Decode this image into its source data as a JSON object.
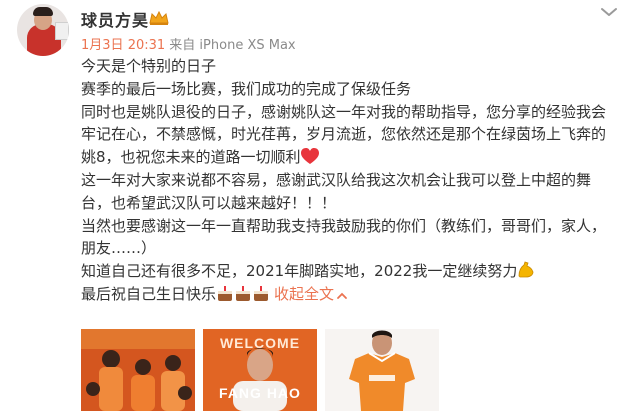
{
  "user": {
    "name": "球员方昊"
  },
  "meta": {
    "date": "1月3日",
    "time": "20:31",
    "source": "来自 iPhone XS Max"
  },
  "post": {
    "lines": [
      "今天是个特别的日子",
      "赛季的最后一场比赛，我们成功的完成了保级任务",
      "同时也是姚队退役的日子，感谢姚队这一年对我的帮助指导，您分享的经验我会",
      "牢记在心，不禁感慨，时光荏苒，岁月流逝，您依然还是那个在绿茵场上飞奔的",
      "姚8，也祝您未来的道路一切顺利",
      "这一年对大家来说都不容易，感谢武汉队给我这次机会让我可以登上中超的舞",
      "台，也希望武汉队可以越来越好！！！",
      "当然也要感谢这一年一直帮助我支持我鼓励我的你们（教练们，哥哥们，家人，",
      "朋友……）",
      "知道自己还有很多不足，2021年脚踏实地，2022我一定继续努力",
      "最后祝自己生日快乐"
    ],
    "expand_label": "收起全文"
  },
  "photos": {
    "photo2_top_text": "WELCOME",
    "photo2_bottom_text": "FANG HAO"
  },
  "colors": {
    "accent": "#eb7350",
    "text": "#333333",
    "muted": "#8a8a8a"
  },
  "icons": [
    "vip-crown-icon",
    "chevron-down-icon",
    "red-heart-icon",
    "cake-icon",
    "flexed-biceps-icon"
  ]
}
